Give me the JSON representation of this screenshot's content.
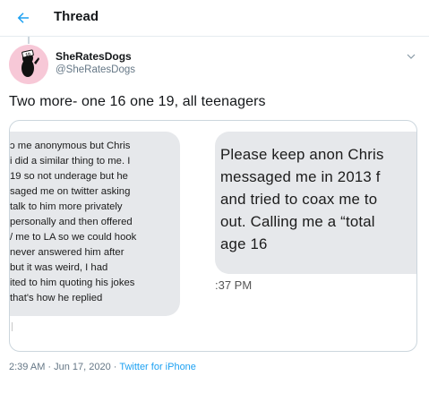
{
  "header": {
    "title": "Thread"
  },
  "tweet": {
    "author_name": "SheRatesDogs",
    "author_handle": "@SheRatesDogs",
    "text": "Two more- one 16 one 19, all teenagers",
    "timestamp": "2:39 AM · Jun 17, 2020 · ",
    "source": "Twitter for iPhone"
  },
  "media": {
    "left_lines": [
      "ɔ me anonymous but Chris",
      "i did a similar thing to me. I",
      "19 so not underage but he",
      "saged me on twitter asking",
      "talk to him more privately",
      "personally and then offered",
      "/ me to LA so we could hook",
      "never answered him after",
      "but it was weird, I had",
      "ited to him quoting his jokes",
      "that's how he replied"
    ],
    "right_lines": [
      "Please keep anon Chris",
      "messaged me in 2013 f",
      "and tried to coax me to",
      "out. Calling me a “total",
      "age 16"
    ],
    "right_time": ":37 PM"
  },
  "colors": {
    "accent": "#1da1f2",
    "muted": "#657786",
    "border": "#ccd6dd",
    "bubble": "#e6e8eb"
  }
}
